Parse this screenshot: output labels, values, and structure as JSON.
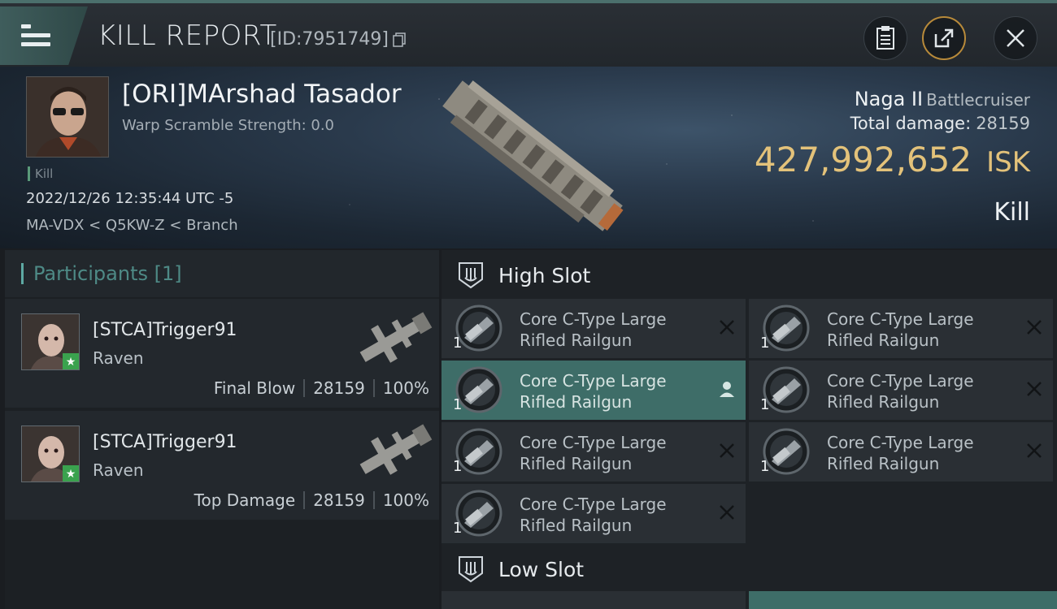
{
  "header": {
    "title": "KILL REPORT",
    "report_id": "[ID:7951749]"
  },
  "victim": {
    "name": "[ORI]MArshad Tasador",
    "warp_scramble": "Warp Scramble Strength: 0.0",
    "tag": "Kill",
    "timestamp": "2022/12/26 12:35:44 UTC -5",
    "location": "MA-VDX < Q5KW-Z < Branch",
    "ship_name": "Naga II",
    "ship_class": "Battlecruiser",
    "total_damage_label": "Total damage:",
    "total_damage_value": "28159",
    "isk_value": "427,992,652",
    "isk_unit": "ISK",
    "result": "Kill"
  },
  "participants": {
    "header": "Participants [1]",
    "items": [
      {
        "name": "[STCA]Trigger91",
        "ship": "Raven",
        "role": "Final Blow",
        "damage": "28159",
        "percent": "100%"
      },
      {
        "name": "[STCA]Trigger91",
        "ship": "Raven",
        "role": "Top Damage",
        "damage": "28159",
        "percent": "100%"
      }
    ]
  },
  "slots": {
    "high_label": "High Slot",
    "low_label": "Low Slot",
    "high_modules": [
      {
        "line1": "Core C-Type Large",
        "line2": "Rifled Railgun",
        "qty": "1",
        "status": "destroyed-icon"
      },
      {
        "line1": "Core C-Type Large",
        "line2": "Rifled Railgun",
        "qty": "1",
        "status": "destroyed-icon"
      },
      {
        "line1": "Core C-Type Large",
        "line2": "Rifled Railgun",
        "qty": "1",
        "status": "dropped-icon"
      },
      {
        "line1": "Core C-Type Large",
        "line2": "Rifled Railgun",
        "qty": "1",
        "status": "destroyed-icon"
      },
      {
        "line1": "Core C-Type Large",
        "line2": "Rifled Railgun",
        "qty": "1",
        "status": "destroyed-icon"
      },
      {
        "line1": "Core C-Type Large",
        "line2": "Rifled Railgun",
        "qty": "1",
        "status": "destroyed-icon"
      },
      {
        "line1": "Core C-Type Large",
        "line2": "Rifled Railgun",
        "qty": "1",
        "status": "destroyed-icon"
      }
    ]
  },
  "colors": {
    "accent_teal": "#3e6d68",
    "isk_gold": "#e3c27a",
    "badge_green": "#3aa24e"
  }
}
